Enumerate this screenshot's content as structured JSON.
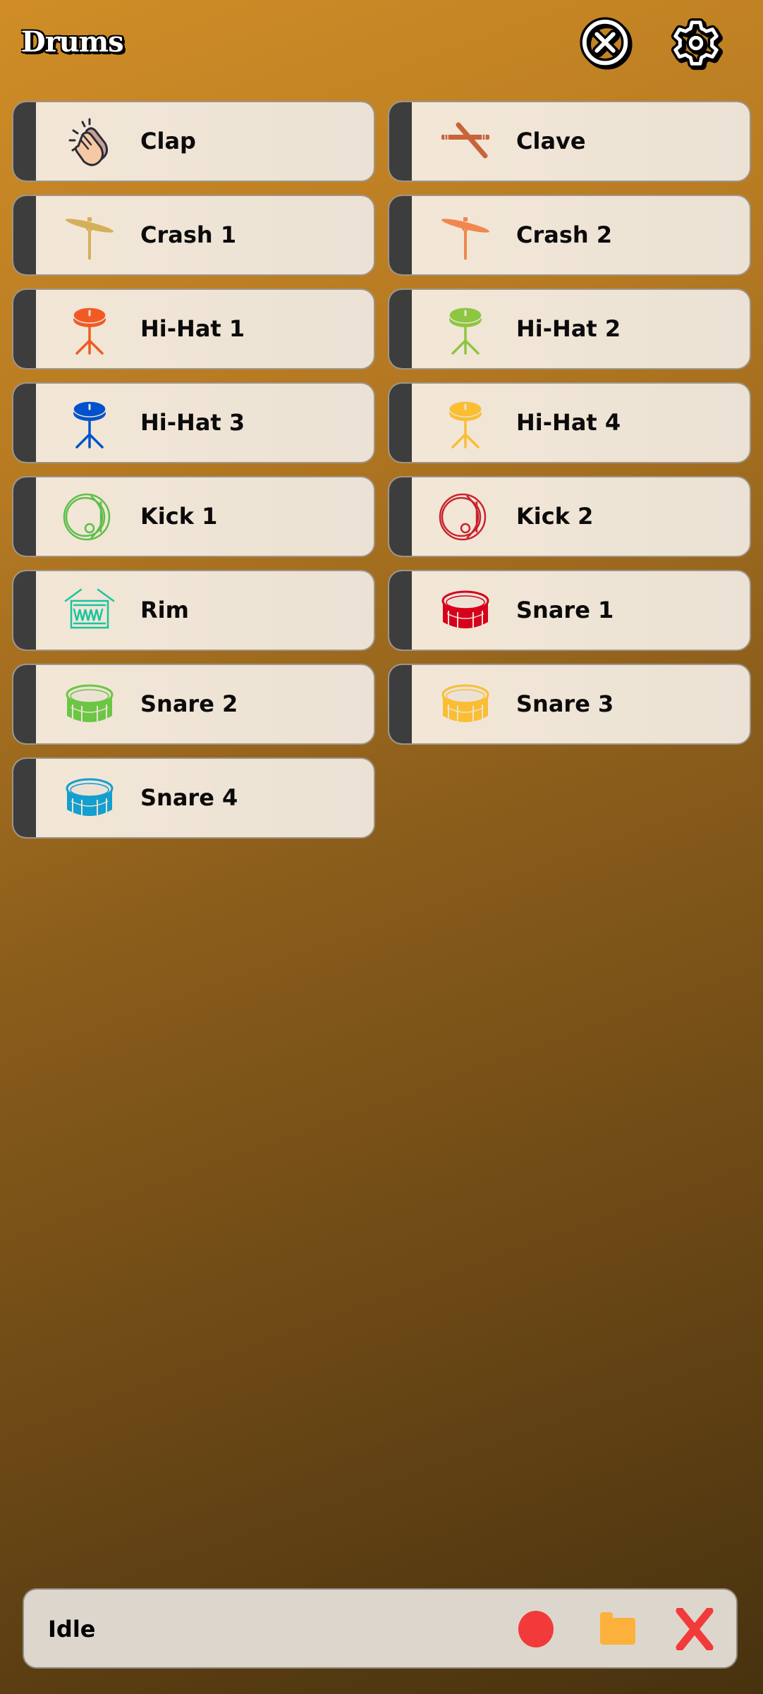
{
  "header": {
    "title": "Drums",
    "close_icon": "close-circle-icon",
    "settings_icon": "gear-icon"
  },
  "pads": [
    {
      "label": "Clap",
      "icon": "clap-hands-icon",
      "color": "#f5c9a3"
    },
    {
      "label": "Clave",
      "icon": "clave-sticks-icon",
      "color": "#c8643a"
    },
    {
      "label": "Crash 1",
      "icon": "crash-cymbal-icon",
      "color": "#d4b05a"
    },
    {
      "label": "Crash 2",
      "icon": "crash-cymbal-icon",
      "color": "#f0874f"
    },
    {
      "label": "Hi-Hat 1",
      "icon": "hihat-icon",
      "color": "#f15a24"
    },
    {
      "label": "Hi-Hat 2",
      "icon": "hihat-icon",
      "color": "#8dc63f"
    },
    {
      "label": "Hi-Hat 3",
      "icon": "hihat-icon",
      "color": "#0052cc"
    },
    {
      "label": "Hi-Hat 4",
      "icon": "hihat-icon",
      "color": "#fbbd32"
    },
    {
      "label": "Kick 1",
      "icon": "kick-drum-icon",
      "color": "#5cbf4a"
    },
    {
      "label": "Kick 2",
      "icon": "kick-drum-icon",
      "color": "#c8242f"
    },
    {
      "label": "Rim",
      "icon": "rim-drum-icon",
      "color": "#19c4a0"
    },
    {
      "label": "Snare 1",
      "icon": "snare-drum-icon",
      "color": "#d7001c"
    },
    {
      "label": "Snare 2",
      "icon": "snare-drum-icon",
      "color": "#6cc644"
    },
    {
      "label": "Snare 3",
      "icon": "snare-drum-icon",
      "color": "#fbbd32"
    },
    {
      "label": "Snare 4",
      "icon": "snare-drum-icon",
      "color": "#139fcf"
    }
  ],
  "bottom_bar": {
    "status": "Idle",
    "record_icon": "record-icon",
    "folder_icon": "folder-icon",
    "clear_icon": "close-x-icon",
    "record_color": "#f23a3a",
    "folder_color": "#fbb13c",
    "clear_color": "#f23a3a"
  }
}
